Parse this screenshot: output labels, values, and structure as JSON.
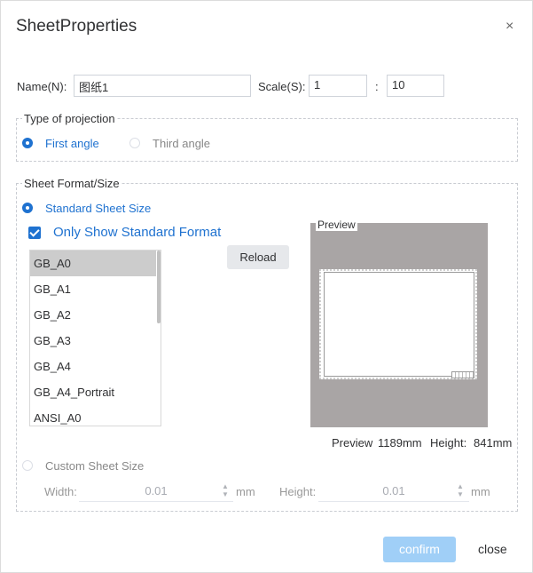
{
  "dialog": {
    "title": "SheetProperties",
    "close_symbol": "×"
  },
  "name_row": {
    "name_label": "Name(N):",
    "name_value": "图纸1",
    "scale_label": "Scale(S):",
    "scale_left": "1",
    "scale_sep": ":",
    "scale_right": "10"
  },
  "projection": {
    "legend": "Type of projection",
    "first_angle": "First angle",
    "third_angle": "Third angle",
    "selected": "First angle"
  },
  "format": {
    "legend": "Sheet Format/Size",
    "standard_label": "Standard Sheet Size",
    "only_standard_label": "Only Show Standard Format",
    "only_standard_checked": true,
    "reload_label": "Reload",
    "sizes": [
      "GB_A0",
      "GB_A1",
      "GB_A2",
      "GB_A3",
      "GB_A4",
      "GB_A4_Portrait",
      "ANSI_A0"
    ],
    "selected_size": "GB_A0",
    "preview_label": "Preview",
    "preview_width_label": "Preview",
    "preview_width_value": "1189mm",
    "preview_height_label": "Height:",
    "preview_height_value": "841mm",
    "custom_label": "Custom Sheet Size",
    "width_label": "Width:",
    "width_value": "0.01",
    "width_unit": "mm",
    "height_label": "Height:",
    "height_value": "0.01",
    "height_unit": "mm"
  },
  "footer": {
    "confirm_label": "confirm",
    "close_label": "close"
  },
  "colors": {
    "accent": "#1f72d0",
    "confirm_disabled": "#a0cff7",
    "preview_bg": "#a9a5a5",
    "selected_row": "#cccccc"
  }
}
